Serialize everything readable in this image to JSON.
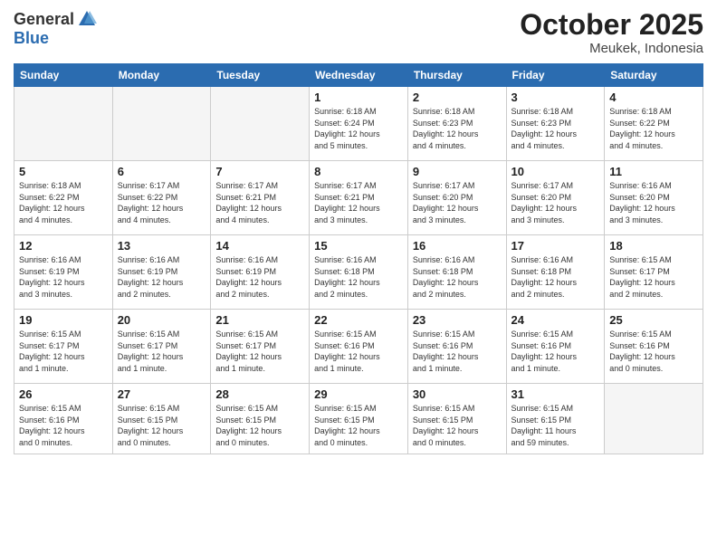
{
  "logo": {
    "general": "General",
    "blue": "Blue"
  },
  "title": "October 2025",
  "location": "Meukek, Indonesia",
  "weekdays": [
    "Sunday",
    "Monday",
    "Tuesday",
    "Wednesday",
    "Thursday",
    "Friday",
    "Saturday"
  ],
  "weeks": [
    [
      {
        "day": "",
        "info": ""
      },
      {
        "day": "",
        "info": ""
      },
      {
        "day": "",
        "info": ""
      },
      {
        "day": "1",
        "info": "Sunrise: 6:18 AM\nSunset: 6:24 PM\nDaylight: 12 hours\nand 5 minutes."
      },
      {
        "day": "2",
        "info": "Sunrise: 6:18 AM\nSunset: 6:23 PM\nDaylight: 12 hours\nand 4 minutes."
      },
      {
        "day": "3",
        "info": "Sunrise: 6:18 AM\nSunset: 6:23 PM\nDaylight: 12 hours\nand 4 minutes."
      },
      {
        "day": "4",
        "info": "Sunrise: 6:18 AM\nSunset: 6:22 PM\nDaylight: 12 hours\nand 4 minutes."
      }
    ],
    [
      {
        "day": "5",
        "info": "Sunrise: 6:18 AM\nSunset: 6:22 PM\nDaylight: 12 hours\nand 4 minutes."
      },
      {
        "day": "6",
        "info": "Sunrise: 6:17 AM\nSunset: 6:22 PM\nDaylight: 12 hours\nand 4 minutes."
      },
      {
        "day": "7",
        "info": "Sunrise: 6:17 AM\nSunset: 6:21 PM\nDaylight: 12 hours\nand 4 minutes."
      },
      {
        "day": "8",
        "info": "Sunrise: 6:17 AM\nSunset: 6:21 PM\nDaylight: 12 hours\nand 3 minutes."
      },
      {
        "day": "9",
        "info": "Sunrise: 6:17 AM\nSunset: 6:20 PM\nDaylight: 12 hours\nand 3 minutes."
      },
      {
        "day": "10",
        "info": "Sunrise: 6:17 AM\nSunset: 6:20 PM\nDaylight: 12 hours\nand 3 minutes."
      },
      {
        "day": "11",
        "info": "Sunrise: 6:16 AM\nSunset: 6:20 PM\nDaylight: 12 hours\nand 3 minutes."
      }
    ],
    [
      {
        "day": "12",
        "info": "Sunrise: 6:16 AM\nSunset: 6:19 PM\nDaylight: 12 hours\nand 3 minutes."
      },
      {
        "day": "13",
        "info": "Sunrise: 6:16 AM\nSunset: 6:19 PM\nDaylight: 12 hours\nand 2 minutes."
      },
      {
        "day": "14",
        "info": "Sunrise: 6:16 AM\nSunset: 6:19 PM\nDaylight: 12 hours\nand 2 minutes."
      },
      {
        "day": "15",
        "info": "Sunrise: 6:16 AM\nSunset: 6:18 PM\nDaylight: 12 hours\nand 2 minutes."
      },
      {
        "day": "16",
        "info": "Sunrise: 6:16 AM\nSunset: 6:18 PM\nDaylight: 12 hours\nand 2 minutes."
      },
      {
        "day": "17",
        "info": "Sunrise: 6:16 AM\nSunset: 6:18 PM\nDaylight: 12 hours\nand 2 minutes."
      },
      {
        "day": "18",
        "info": "Sunrise: 6:15 AM\nSunset: 6:17 PM\nDaylight: 12 hours\nand 2 minutes."
      }
    ],
    [
      {
        "day": "19",
        "info": "Sunrise: 6:15 AM\nSunset: 6:17 PM\nDaylight: 12 hours\nand 1 minute."
      },
      {
        "day": "20",
        "info": "Sunrise: 6:15 AM\nSunset: 6:17 PM\nDaylight: 12 hours\nand 1 minute."
      },
      {
        "day": "21",
        "info": "Sunrise: 6:15 AM\nSunset: 6:17 PM\nDaylight: 12 hours\nand 1 minute."
      },
      {
        "day": "22",
        "info": "Sunrise: 6:15 AM\nSunset: 6:16 PM\nDaylight: 12 hours\nand 1 minute."
      },
      {
        "day": "23",
        "info": "Sunrise: 6:15 AM\nSunset: 6:16 PM\nDaylight: 12 hours\nand 1 minute."
      },
      {
        "day": "24",
        "info": "Sunrise: 6:15 AM\nSunset: 6:16 PM\nDaylight: 12 hours\nand 1 minute."
      },
      {
        "day": "25",
        "info": "Sunrise: 6:15 AM\nSunset: 6:16 PM\nDaylight: 12 hours\nand 0 minutes."
      }
    ],
    [
      {
        "day": "26",
        "info": "Sunrise: 6:15 AM\nSunset: 6:16 PM\nDaylight: 12 hours\nand 0 minutes."
      },
      {
        "day": "27",
        "info": "Sunrise: 6:15 AM\nSunset: 6:15 PM\nDaylight: 12 hours\nand 0 minutes."
      },
      {
        "day": "28",
        "info": "Sunrise: 6:15 AM\nSunset: 6:15 PM\nDaylight: 12 hours\nand 0 minutes."
      },
      {
        "day": "29",
        "info": "Sunrise: 6:15 AM\nSunset: 6:15 PM\nDaylight: 12 hours\nand 0 minutes."
      },
      {
        "day": "30",
        "info": "Sunrise: 6:15 AM\nSunset: 6:15 PM\nDaylight: 12 hours\nand 0 minutes."
      },
      {
        "day": "31",
        "info": "Sunrise: 6:15 AM\nSunset: 6:15 PM\nDaylight: 11 hours\nand 59 minutes."
      },
      {
        "day": "",
        "info": ""
      }
    ]
  ]
}
